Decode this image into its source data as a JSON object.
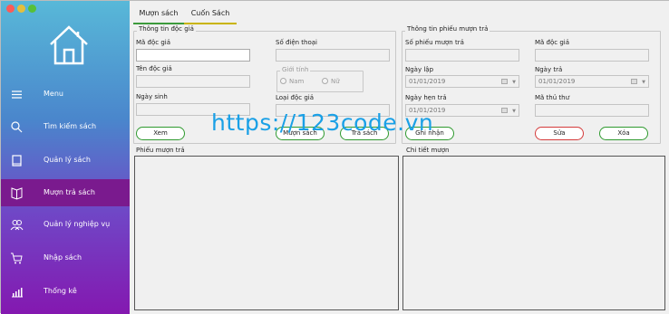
{
  "sidebar": {
    "items": [
      {
        "label": "Menu",
        "icon": "hamburger-icon"
      },
      {
        "label": "Tìm kiếm sách",
        "icon": "search-icon"
      },
      {
        "label": "Quản lý sách",
        "icon": "book-icon"
      },
      {
        "label": "Mượn trả sách",
        "icon": "open-book-icon"
      },
      {
        "label": "Quản lý nghiệp vụ",
        "icon": "users-icon"
      },
      {
        "label": "Nhập sách",
        "icon": "cart-icon"
      },
      {
        "label": "Thống kê",
        "icon": "bar-chart-icon"
      }
    ],
    "active_index": 3
  },
  "tabs": [
    "Mượn sách",
    "Cuốn Sách"
  ],
  "reader_group": {
    "title": "Thông tin độc giả",
    "ma_doc_gia": "Mã độc giả",
    "ten_doc_gia": "Tên độc giả",
    "ngay_sinh": "Ngày sinh",
    "so_dien_thoai": "Số điện thoại",
    "gioi_tinh": "Giới tính",
    "nam": "Nam",
    "nu": "Nữ",
    "loai_doc_gia": "Loại độc giả"
  },
  "loan_group": {
    "title": "Thông tin phiếu mượn trả",
    "so_phieu": "Số phiếu mượn trả",
    "ma_doc_gia": "Mã độc giả",
    "ngay_lap": "Ngày lập",
    "ngay_lap_value": "01/01/2019",
    "ngay_tra": "Ngày trả",
    "ngay_tra_value": "01/01/2019",
    "ngay_hen_tra": "Ngày hẹn trả",
    "ngay_hen_tra_value": "01/01/2019",
    "ma_thu_thu": "Mã thủ thư"
  },
  "buttons": {
    "xem": "Xem",
    "muon_sach": "Mượn sách",
    "tra_sach": "Trả sách",
    "ghi_nhan": "Ghi nhận",
    "sua": "Sửa",
    "xoa": "Xóa"
  },
  "panels": {
    "phieu_muon_tra": "Phiếu mượn trả",
    "chi_tiet_muon": "Chi tiết mượn"
  },
  "watermark": "https://123code.vn",
  "colors": {
    "close": "#fc5b57",
    "minimize": "#e5bf3c",
    "maximize": "#57c038",
    "active_nav": "#7a1a8e",
    "green_border": "#2f9a2f",
    "red_border": "#d43a3a",
    "watermark": "#1aa0e6"
  }
}
